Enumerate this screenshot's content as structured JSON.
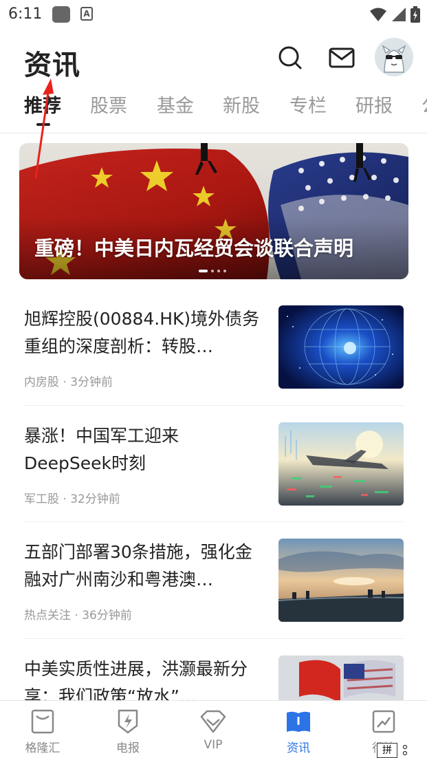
{
  "status_bar": {
    "time": "6:11",
    "icons": [
      "app-icon",
      "text-a-icon",
      "wifi-icon",
      "signal-icon",
      "battery-icon"
    ]
  },
  "header": {
    "title": "资讯",
    "icons": [
      "search-icon",
      "mail-icon",
      "avatar"
    ]
  },
  "tabs": [
    {
      "label": "推荐",
      "active": true
    },
    {
      "label": "股票",
      "active": false
    },
    {
      "label": "基金",
      "active": false
    },
    {
      "label": "新股",
      "active": false
    },
    {
      "label": "专栏",
      "active": false
    },
    {
      "label": "研报",
      "active": false
    },
    {
      "label": "公",
      "active": false
    }
  ],
  "banner": {
    "title": "重磅！中美日内瓦经贸会谈联合声明",
    "pages": 4,
    "current_page": 1
  },
  "news": [
    {
      "title": "旭辉控股(00884.HK)境外债务重组的深度剖析：转股…",
      "tag": "内房股",
      "time": "3分钟前",
      "thumb": "digital-globe-image"
    },
    {
      "title": "暴涨！中国军工迎来DeepSeek时刻",
      "tag": "军工股",
      "time": "32分钟前",
      "thumb": "aircraft-image"
    },
    {
      "title": "五部门部署30条措施，强化金融对广州南沙和粤港澳…",
      "tag": "热点关注",
      "time": "36分钟前",
      "thumb": "city-sunset-image"
    },
    {
      "title": "中美实质性进展，洪灏最新分享：我们政策“放水”…",
      "tag": "",
      "time": "",
      "thumb": "flags-image"
    }
  ],
  "meta_separator": " · ",
  "bottom_nav": [
    {
      "label": "格隆汇",
      "icon": "glh-icon",
      "active": false
    },
    {
      "label": "电报",
      "icon": "telegram-icon",
      "active": false
    },
    {
      "label": "VIP",
      "icon": "vip-icon",
      "active": false
    },
    {
      "label": "资讯",
      "icon": "news-icon",
      "active": true
    },
    {
      "label": "行情",
      "icon": "market-icon",
      "active": false
    }
  ],
  "ime_badge": "拼",
  "colors": {
    "accent": "#2b73e6",
    "text_primary": "#222222",
    "text_secondary": "#999999"
  }
}
